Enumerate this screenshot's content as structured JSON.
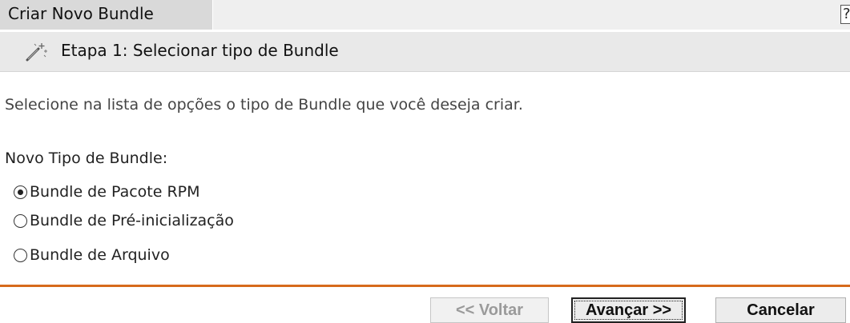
{
  "header": {
    "title": "Criar Novo Bundle",
    "help_label": "?"
  },
  "step": {
    "icon": "magic-wand-icon",
    "title": "Etapa 1: Selecionar tipo de Bundle"
  },
  "content": {
    "instructions": "Selecione na lista de opções o tipo de Bundle que você deseja criar.",
    "group_label": "Novo Tipo de Bundle:",
    "options": [
      {
        "label": "Bundle de Pacote RPM",
        "selected": true
      },
      {
        "label": "Bundle de Pré-inicialização",
        "selected": false
      },
      {
        "label": "Bundle de Arquivo",
        "selected": false
      }
    ]
  },
  "footer": {
    "back_label": "<< Voltar",
    "next_label": "Avançar >>",
    "cancel_label": "Cancelar"
  },
  "colors": {
    "divider": "#d66a1c",
    "title_tab": "#d9d9d9",
    "step_bar": "#e9e9e9"
  }
}
